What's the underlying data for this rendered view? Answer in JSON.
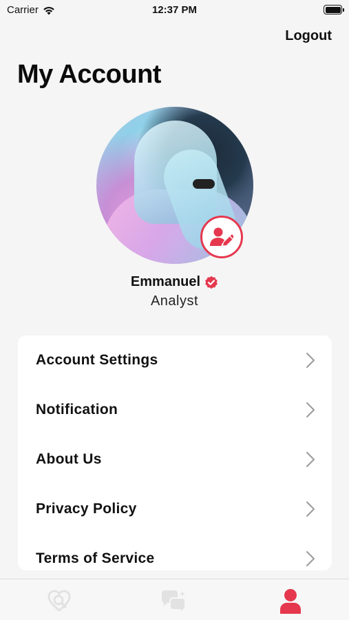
{
  "status_bar": {
    "carrier": "Carrier",
    "time": "12:37 PM"
  },
  "header": {
    "logout_label": "Logout",
    "title": "My Account"
  },
  "profile": {
    "name": "Emmanuel",
    "role": "Analyst",
    "verified": true
  },
  "menu": {
    "items": [
      {
        "label": "Account Settings"
      },
      {
        "label": "Notification"
      },
      {
        "label": "About Us"
      },
      {
        "label": "Privacy Policy"
      },
      {
        "label": "Terms of Service"
      }
    ]
  },
  "tab_bar": {
    "tabs": [
      {
        "icon": "heart-search-icon",
        "active": false
      },
      {
        "icon": "chat-bubbles-icon",
        "active": false
      },
      {
        "icon": "user-icon",
        "active": true
      }
    ]
  },
  "colors": {
    "accent": "#e5384e",
    "inactive_icon": "#e2e2e2",
    "background": "#f5f5f5",
    "card": "#ffffff"
  }
}
